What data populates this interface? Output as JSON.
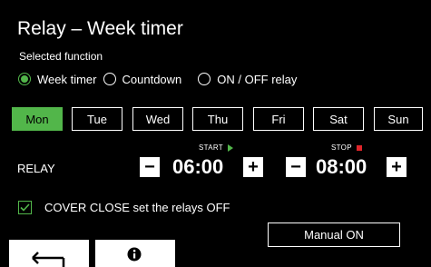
{
  "header": {
    "title": "Relay – Week timer",
    "subtitle": "Selected function"
  },
  "function_options": [
    {
      "label": "Week timer",
      "selected": true
    },
    {
      "label": "Countdown",
      "selected": false
    },
    {
      "label": "ON / OFF relay",
      "selected": false
    }
  ],
  "days": [
    {
      "label": "Mon",
      "active": true
    },
    {
      "label": "Tue",
      "active": false
    },
    {
      "label": "Wed",
      "active": false
    },
    {
      "label": "Thu",
      "active": false
    },
    {
      "label": "Fri",
      "active": false
    },
    {
      "label": "Sat",
      "active": false
    },
    {
      "label": "Sun",
      "active": false
    }
  ],
  "relay": {
    "label": "RELAY",
    "start_label": "START",
    "stop_label": "STOP",
    "start_time": "06:00",
    "stop_time": "08:00",
    "minus": "−",
    "plus": "+"
  },
  "cover_option": {
    "label": "COVER CLOSE set the relays OFF",
    "checked": true
  },
  "manual_button": "Manual ON",
  "colors": {
    "accent": "#52b64a",
    "stop": "#e0252a",
    "background": "#000000"
  },
  "icons": {
    "back": "return-arrow-icon",
    "info": "info-icon"
  }
}
